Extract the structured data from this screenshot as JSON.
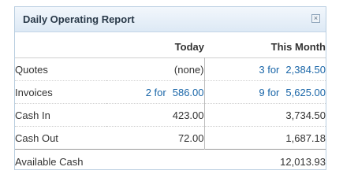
{
  "panel": {
    "title": "Daily Operating Report",
    "close_icon": "×"
  },
  "columns": {
    "today": "Today",
    "this_month": "This Month"
  },
  "rows": {
    "quotes": {
      "label": "Quotes",
      "today": "(none)",
      "month_count": "3 for",
      "month_amount": "2,384.50"
    },
    "invoices": {
      "label": "Invoices",
      "today_count": "2 for",
      "today_amount": "586.00",
      "month_count": "9 for",
      "month_amount": "5,625.00"
    },
    "cash_in": {
      "label": "Cash In",
      "today": "423.00",
      "month": "3,734.50"
    },
    "cash_out": {
      "label": "Cash Out",
      "today": "72.00",
      "month": "1,687.18"
    }
  },
  "total": {
    "label": "Available Cash",
    "value": "12,013.93"
  },
  "colors": {
    "link": "#1a66a8",
    "header_gradient_top": "#f2f7fc",
    "header_gradient_bottom": "#dde9f5",
    "border": "#b8cde0"
  }
}
